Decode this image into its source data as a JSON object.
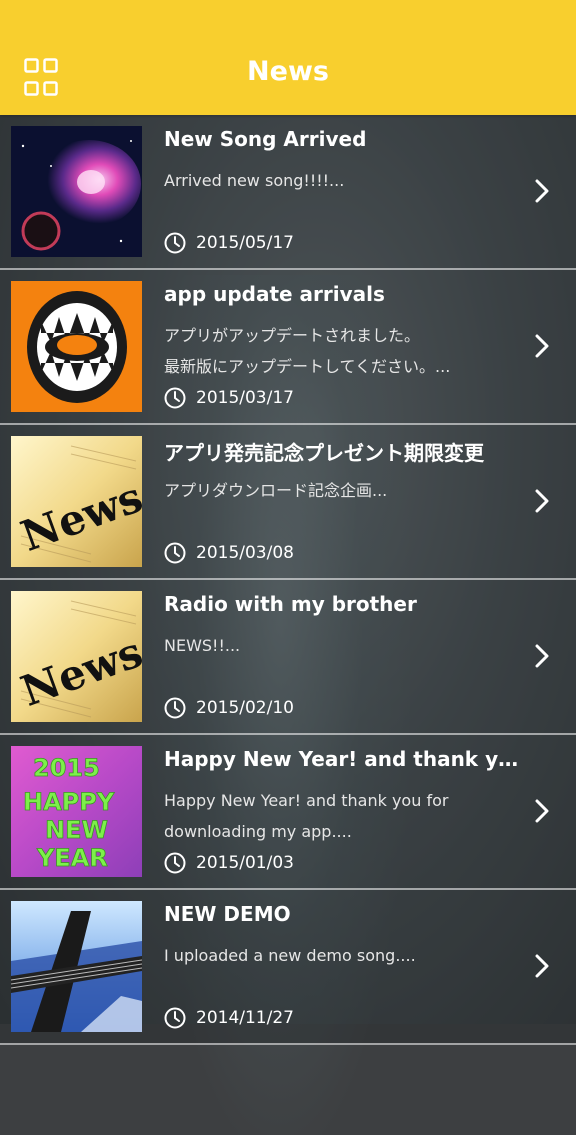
{
  "header": {
    "title": "News",
    "menu_icon": "grid-menu-icon",
    "background_color": "#f8cf2e"
  },
  "news": [
    {
      "title": "New Song Arrived",
      "description": [
        "Arrived new song!!!!..."
      ],
      "date": "2015/05/17",
      "thumbnail": "nebula-image"
    },
    {
      "title": "app  update arrivals",
      "description": [
        "アプリがアップデートされました。",
        "最新版にアップデートしてください。..."
      ],
      "date": "2015/03/17",
      "thumbnail": "monster-mouth-logo"
    },
    {
      "title": "アプリ発売記念プレゼント期限変更",
      "description": [
        "アプリダウンロード記念企画..."
      ],
      "date": "2015/03/08",
      "thumbnail": "news-newspaper-image"
    },
    {
      "title": "Radio with my brother",
      "description": [
        "NEWS!!..."
      ],
      "date": "2015/02/10",
      "thumbnail": "news-newspaper-image"
    },
    {
      "title": "Happy New Year! and thank you for downloading my app.",
      "description": [
        "Happy New Year! and thank you for",
        "downloading my app...."
      ],
      "date": "2015/01/03",
      "thumbnail": "happy-new-year-image",
      "thumb_text": [
        "2015",
        "HAPPY",
        "NEW",
        "YEAR"
      ]
    },
    {
      "title": "NEW DEMO",
      "description": [
        "I uploaded a new demo song...."
      ],
      "date": "2014/11/27",
      "thumbnail": "guitar-image"
    }
  ]
}
